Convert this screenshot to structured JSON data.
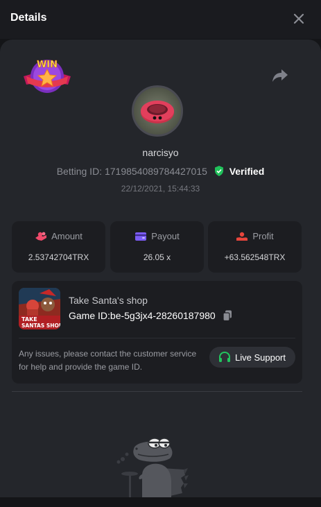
{
  "header": {
    "title": "Details"
  },
  "badge": {
    "text": "WIN"
  },
  "player": {
    "username": "narcisyo",
    "betting_label": "Betting ID:",
    "betting_id": "1719854089784427015",
    "verified_label": "Verified",
    "datetime": "22/12/2021, 15:44:33"
  },
  "stats": [
    {
      "label": "Amount",
      "value": "2.53742704TRX",
      "icon": "coins-icon",
      "color": "#f04a6b"
    },
    {
      "label": "Payout",
      "value": "26.05 x",
      "icon": "wallet-icon",
      "color": "#7b5cf5"
    },
    {
      "label": "Profit",
      "value": "+63.562548TRX",
      "icon": "hand-coin-icon",
      "color": "#e8453c"
    }
  ],
  "game": {
    "name": "Take Santa's shop",
    "id_label": "Game ID:",
    "id_value": "be-5g3jx4-28260187980",
    "thumb_text_line1": "TAKE",
    "thumb_text_line2": "SANTAS SHOP",
    "support_text": "Any issues, please contact the customer service for help and provide the game ID.",
    "live_support_label": "Live Support"
  },
  "colors": {
    "background": "#141518",
    "panel": "#24262b",
    "card": "#1c1d21",
    "verified": "#20c05a",
    "support_icon": "#22c55e"
  }
}
